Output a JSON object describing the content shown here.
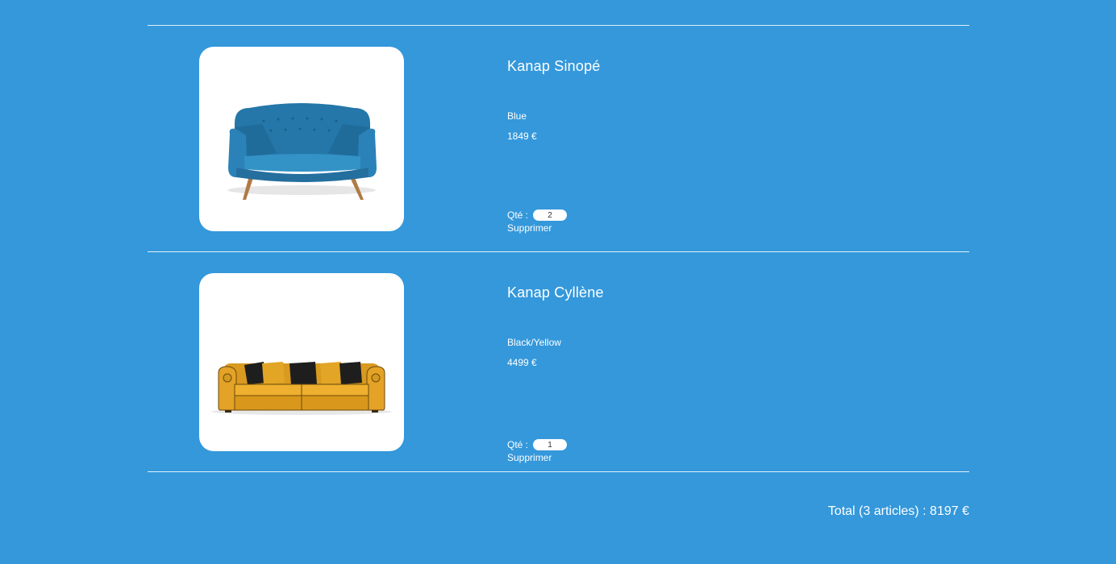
{
  "cart": {
    "items": [
      {
        "name": "Kanap Sinopé",
        "color": "Blue",
        "price": "1849 €",
        "qty_label": "Qté :",
        "qty_value": "2",
        "delete_label": "Supprimer",
        "image_icon": "blue-sofa-image"
      },
      {
        "name": "Kanap Cyllène",
        "color": "Black/Yellow",
        "price": "4499 €",
        "qty_label": "Qté :",
        "qty_value": "1",
        "delete_label": "Supprimer",
        "image_icon": "yellow-sofa-image"
      }
    ],
    "total": "Total (3 articles) : 8197 €"
  },
  "colors": {
    "background": "#3498db",
    "text": "#ffffff",
    "card": "#ffffff"
  }
}
